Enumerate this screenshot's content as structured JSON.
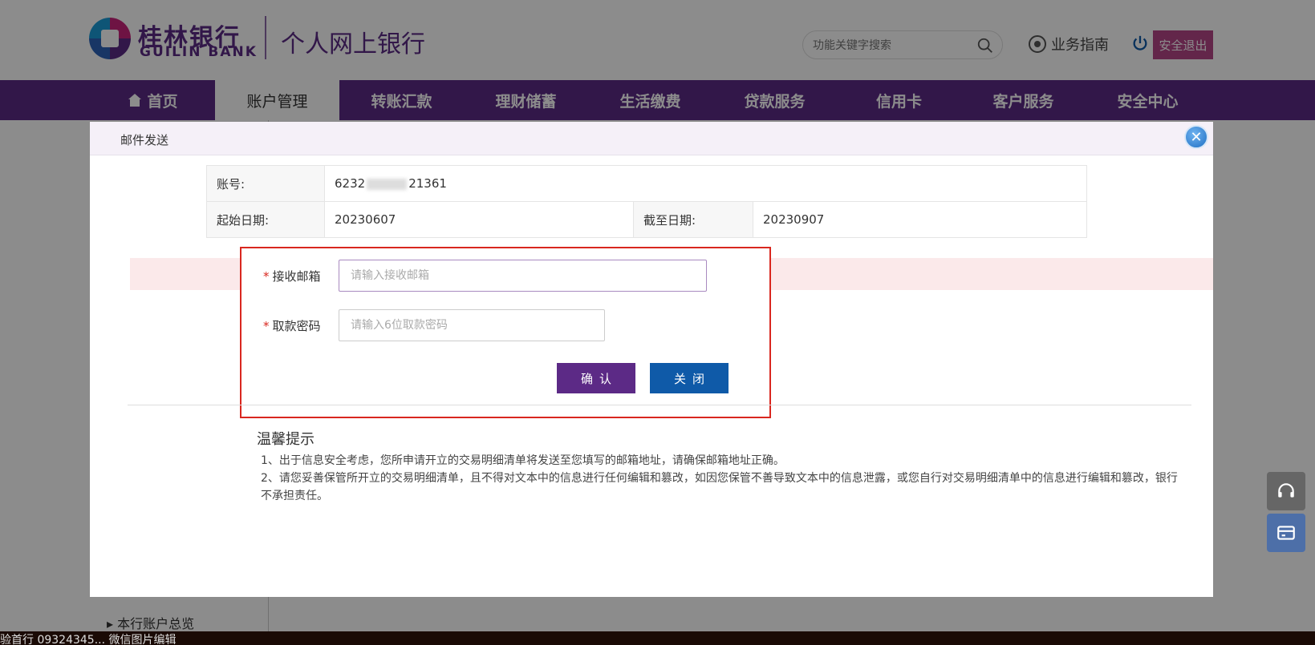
{
  "header": {
    "logo_cn": "桂林银行",
    "logo_en": "GUILIN BANK",
    "site_title": "个人网上银行",
    "search_placeholder": "功能关键字搜索",
    "guide_label": "业务指南",
    "logout_label": "安全退出"
  },
  "nav": {
    "items": [
      {
        "label": "首页"
      },
      {
        "label": "账户管理"
      },
      {
        "label": "转账汇款"
      },
      {
        "label": "理财储蓄"
      },
      {
        "label": "生活缴费"
      },
      {
        "label": "贷款服务"
      },
      {
        "label": "信用卡"
      },
      {
        "label": "客户服务"
      },
      {
        "label": "安全中心"
      }
    ]
  },
  "sidebar": {
    "item_label": "本行账户总览"
  },
  "bottom_strip_text": "验首行 09324345... 微信图片编辑",
  "dialog": {
    "title": "邮件发送",
    "account_label": "账号:",
    "account_prefix": "6232",
    "account_suffix": "21361",
    "start_label": "起始日期:",
    "start_value": "20230607",
    "end_label": "截至日期:",
    "end_value": "20230907",
    "email_label": "接收邮箱",
    "email_placeholder": "请输入接收邮箱",
    "password_label": "取款密码",
    "password_placeholder": "请输入6位取款密码",
    "confirm_label": "确认",
    "close_label": "关闭",
    "tips_title": "温馨提示",
    "tips": [
      "1、出于信息安全考虑，您所申请开立的交易明细清单将发送至您填写的邮箱地址，请确保邮箱地址正确。",
      "2、请您妥善保管所开立的交易明细清单，且不得对文本中的信息进行任何编辑和篡改，如因您保管不善导致文本中的信息泄露，或您自行对交易明细清单中的信息进行编辑和篡改，银行不承担责任。"
    ]
  },
  "colors": {
    "brand_purple": "#5c2a86",
    "logout_pink": "#b44688",
    "close_blue": "#0f5aa8",
    "highlight_red": "#d9271f"
  }
}
